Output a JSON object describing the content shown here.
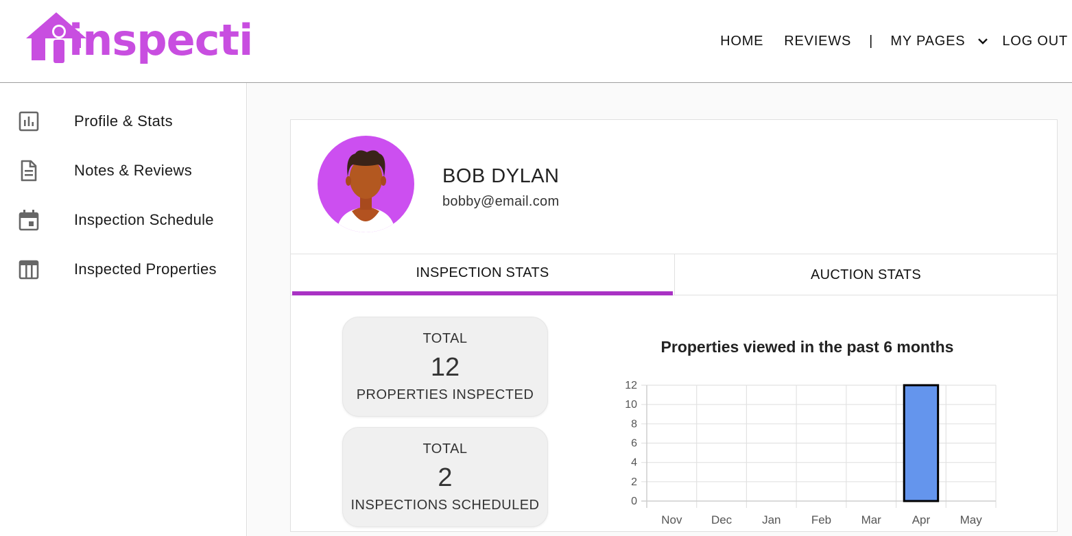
{
  "header": {
    "logo_text": "inspecti",
    "nav": {
      "home": "HOME",
      "reviews": "REVIEWS",
      "separator": "|",
      "my_pages": "MY PAGES",
      "logout": "LOG OUT"
    }
  },
  "sidebar": {
    "items": [
      {
        "label": "Profile & Stats",
        "icon": "bar-chart-icon"
      },
      {
        "label": "Notes & Reviews",
        "icon": "document-icon"
      },
      {
        "label": "Inspection Schedule",
        "icon": "calendar-icon"
      },
      {
        "label": "Inspected Properties",
        "icon": "table-icon"
      }
    ]
  },
  "profile": {
    "name": "BOB DYLAN",
    "email": "bobby@email.com"
  },
  "tabs": {
    "items": [
      {
        "label": "INSPECTION STATS",
        "active": true
      },
      {
        "label": "AUCTION STATS",
        "active": false
      }
    ]
  },
  "stats": {
    "properties": {
      "top": "TOTAL",
      "value": "12",
      "bottom": "PROPERTIES INSPECTED"
    },
    "scheduled": {
      "top": "TOTAL",
      "value": "2",
      "bottom": "INSPECTIONS SCHEDULED"
    }
  },
  "colors": {
    "brand": "#c84ee0",
    "tab_accent": "#a932c4",
    "bar_fill": "#6495ed"
  },
  "chart_data": {
    "type": "bar",
    "title": "Properties viewed in the past 6 months",
    "categories": [
      "Nov",
      "Dec",
      "Jan",
      "Feb",
      "Mar",
      "Apr",
      "May"
    ],
    "values": [
      0,
      0,
      0,
      0,
      0,
      12,
      0
    ],
    "yticks": [
      0,
      2,
      4,
      6,
      8,
      10,
      12
    ],
    "ylim": [
      0,
      12
    ],
    "grid": true,
    "legend": "none"
  }
}
